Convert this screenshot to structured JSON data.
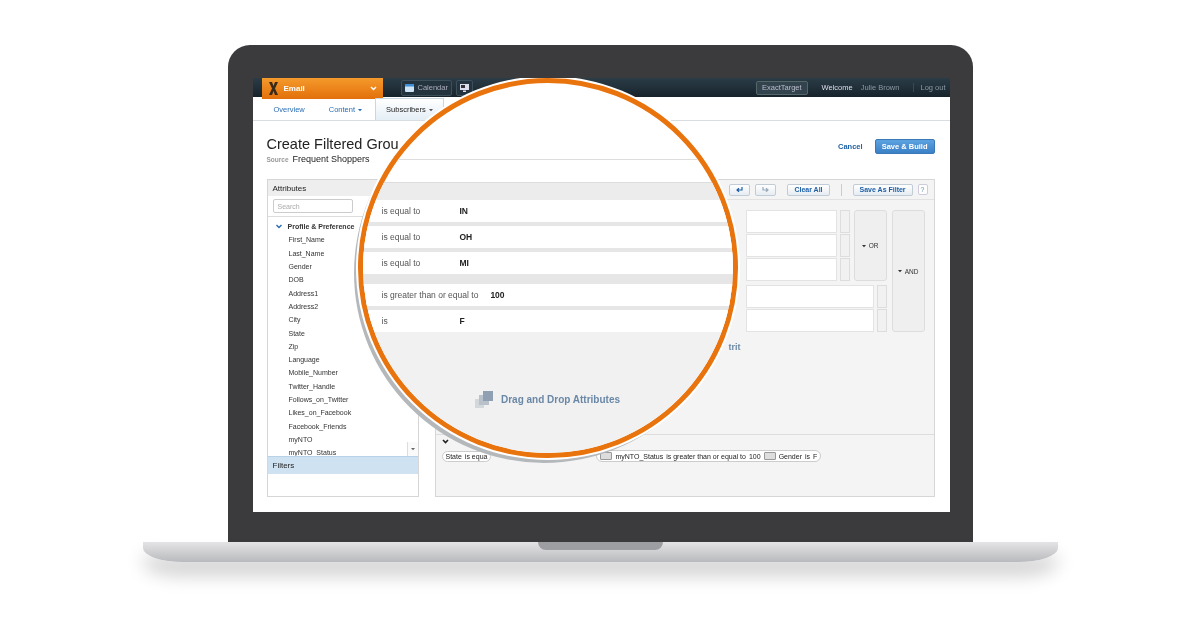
{
  "app_bar": {
    "product": "Email",
    "nav_items": [
      {
        "label": "Calendar"
      }
    ],
    "brand_button": "ExactTarget",
    "welcome": "Welcome",
    "user": "Julie Brown",
    "logout": "Log out"
  },
  "tabs": [
    {
      "label": "Overview",
      "selected": false,
      "dropdown": false
    },
    {
      "label": "Content",
      "selected": false,
      "dropdown": true
    },
    {
      "label": "Subscribers",
      "selected": true,
      "dropdown": true
    }
  ],
  "page": {
    "title": "Create Filtered Grou",
    "source_label": "Source",
    "source": "Frequent Shoppers",
    "cancel": "Cancel",
    "save": "Save & Build"
  },
  "attributes": {
    "title": "Attributes",
    "search_placeholder": "Search",
    "tree": [
      {
        "label": "Profile & Preference",
        "expanded": true,
        "children": [
          {
            "label": "First_Name"
          },
          {
            "label": "Last_Name"
          },
          {
            "label": "Gender"
          },
          {
            "label": "DOB"
          },
          {
            "label": "Address1"
          },
          {
            "label": "Address2"
          },
          {
            "label": "City"
          },
          {
            "label": "State"
          },
          {
            "label": "Zip"
          },
          {
            "label": "Language"
          },
          {
            "label": "Mobile_Number"
          },
          {
            "label": "Twitter_Handle"
          },
          {
            "label": "Follows_on_Twitter"
          },
          {
            "label": "Likes_on_Facebook"
          },
          {
            "label": "Facebook_Friends"
          },
          {
            "label": "myNTO"
          },
          {
            "label": "myNTO_Status"
          }
        ]
      }
    ]
  },
  "filters_panel": {
    "title": "Filters"
  },
  "toolbar": {
    "clear": "Clear All",
    "save_filter": "Save As Filter",
    "help": "?"
  },
  "rule_groups": [
    {
      "connector": "OR",
      "rules": [
        {
          "operator": "is equal to",
          "value": "IN"
        },
        {
          "operator": "is equal to",
          "value": "OH"
        },
        {
          "operator": "is equal to",
          "value": "MI"
        }
      ]
    },
    {
      "rules": [
        {
          "operator": "is greater than or equal to",
          "value": "100"
        },
        {
          "operator": "is",
          "value": "F"
        }
      ]
    }
  ],
  "outer_connector": "AND",
  "drop_hint": "Drag and Drop Attributes",
  "hint_fragment": "trit",
  "summary": {
    "left": [
      {
        "kind": "text",
        "text": "State"
      },
      {
        "kind": "text",
        "text": "is equa"
      }
    ],
    "right": [
      {
        "kind": "badge"
      },
      {
        "kind": "text",
        "text": "myNTO_Status"
      },
      {
        "kind": "text",
        "text": "is greater than or equal to"
      },
      {
        "kind": "text",
        "text": "100"
      },
      {
        "kind": "badge"
      },
      {
        "kind": "text",
        "text": "Gender"
      },
      {
        "kind": "text",
        "text": "is"
      },
      {
        "kind": "text",
        "text": "F"
      }
    ]
  }
}
